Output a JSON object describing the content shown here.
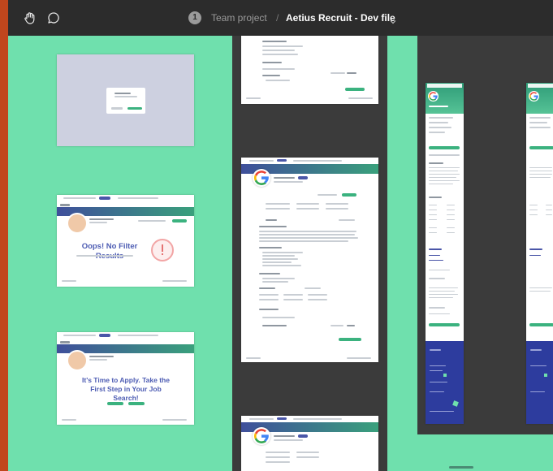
{
  "toolbar": {
    "hand_tool_icon": "hand-icon",
    "comment_tool_icon": "comment-icon",
    "avatar_initial": "1",
    "team_label": "Team project",
    "separator": "/",
    "file_name": "Aetius Recruit - Dev file",
    "chevron_icon": "chevron-down-icon"
  },
  "canvas": {
    "frames": [
      {
        "name": "dialog-frame"
      },
      {
        "name": "no-results-frame",
        "message": "Oops! No Filter Results"
      },
      {
        "name": "apply-frame",
        "message": "It's Time to Apply. Take the First Step in Your Job Search!"
      }
    ]
  },
  "colors": {
    "canvas": "#6fe0ad",
    "toolbar": "#2c2c2c",
    "dark_column": "#3b3b3b",
    "accent_blue": "#4a56a8",
    "accent_green": "#3bb27f",
    "border": "#c0461d"
  }
}
